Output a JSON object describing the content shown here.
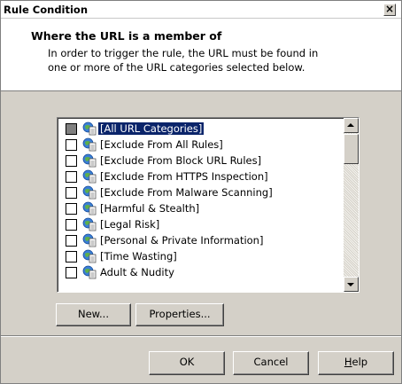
{
  "window": {
    "title": "Rule Condition",
    "close_glyph": "×"
  },
  "header": {
    "title": "Where the URL is a member of",
    "description_line1": "In order to trigger the rule, the URL must be found in",
    "description_line2": "one or more of the URL categories selected below."
  },
  "categories": [
    {
      "label": "[All URL Categories]",
      "checked": "indeterminate",
      "selected": true,
      "icon": "url-category-icon"
    },
    {
      "label": "[Exclude From All Rules]",
      "checked": false,
      "icon": "url-category-icon"
    },
    {
      "label": "[Exclude From Block URL Rules]",
      "checked": false,
      "icon": "url-category-icon"
    },
    {
      "label": "[Exclude From HTTPS Inspection]",
      "checked": false,
      "icon": "url-category-icon"
    },
    {
      "label": "[Exclude From Malware Scanning]",
      "checked": false,
      "icon": "url-category-icon"
    },
    {
      "label": "[Harmful & Stealth]",
      "checked": false,
      "icon": "url-category-icon"
    },
    {
      "label": "[Legal Risk]",
      "checked": false,
      "icon": "url-category-icon"
    },
    {
      "label": "[Personal & Private Information]",
      "checked": false,
      "icon": "url-category-icon"
    },
    {
      "label": "[Time Wasting]",
      "checked": false,
      "icon": "url-category-icon"
    },
    {
      "label": "Adult & Nudity",
      "checked": false,
      "icon": "url-category-icon"
    }
  ],
  "buttons": {
    "new": "New...",
    "properties": "Properties...",
    "ok": "OK",
    "cancel": "Cancel",
    "help_mnemonic": "H",
    "help_rest": "elp"
  },
  "colors": {
    "selection": "#0a246a",
    "dialog_face": "#d4d0c8"
  }
}
